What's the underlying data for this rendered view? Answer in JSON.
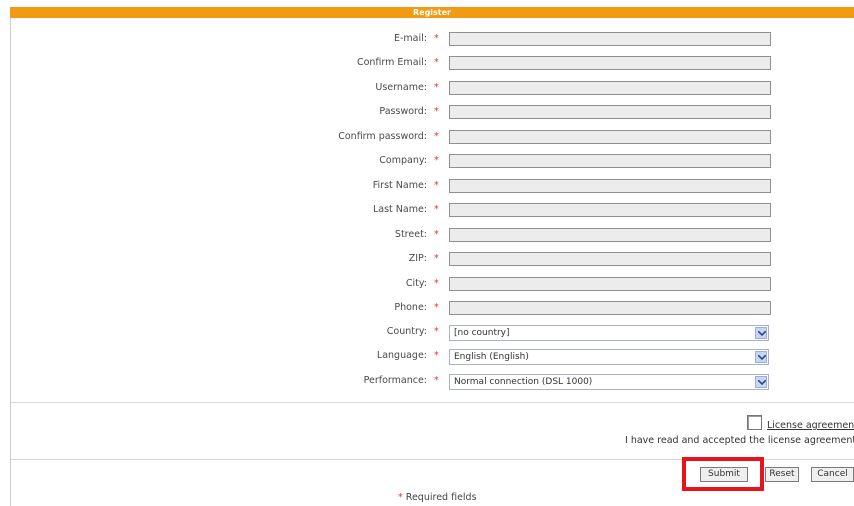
{
  "header": {
    "title": "Register"
  },
  "fields": [
    {
      "label": "E-mail:",
      "required": "*",
      "value": ""
    },
    {
      "label": "Confirm Email:",
      "required": "*",
      "value": ""
    },
    {
      "label": "Username:",
      "required": "*",
      "value": ""
    },
    {
      "label": "Password:",
      "required": "*",
      "value": ""
    },
    {
      "label": "Confirm password:",
      "required": "*",
      "value": ""
    },
    {
      "label": "Company:",
      "required": "*",
      "value": ""
    },
    {
      "label": "First Name:",
      "required": "*",
      "value": ""
    },
    {
      "label": "Last Name:",
      "required": "*",
      "value": ""
    },
    {
      "label": "Street:",
      "required": "*",
      "value": ""
    },
    {
      "label": "ZIP:",
      "required": "*",
      "value": ""
    },
    {
      "label": "City:",
      "required": "*",
      "value": ""
    },
    {
      "label": "Phone:",
      "required": "*",
      "value": ""
    }
  ],
  "selects": [
    {
      "label": "Country:",
      "required": "*",
      "value": "[no country]"
    },
    {
      "label": "Language:",
      "required": "*",
      "value": "English (English)"
    },
    {
      "label": "Performance:",
      "required": "*",
      "value": "Normal connection (DSL 1000)"
    }
  ],
  "license": {
    "link_label": "License agreement",
    "accept_text": "I have read and accepted the license agreement"
  },
  "buttons": {
    "submit": "Submit",
    "reset": "Reset",
    "cancel": "Cancel"
  },
  "footnote": {
    "star": "*",
    "text": "Required fields"
  },
  "colors": {
    "header": "#f29a14",
    "required": "#e23030",
    "highlight": "#e8141b"
  },
  "icons": {
    "select_arrow": "chevron-down-icon"
  }
}
